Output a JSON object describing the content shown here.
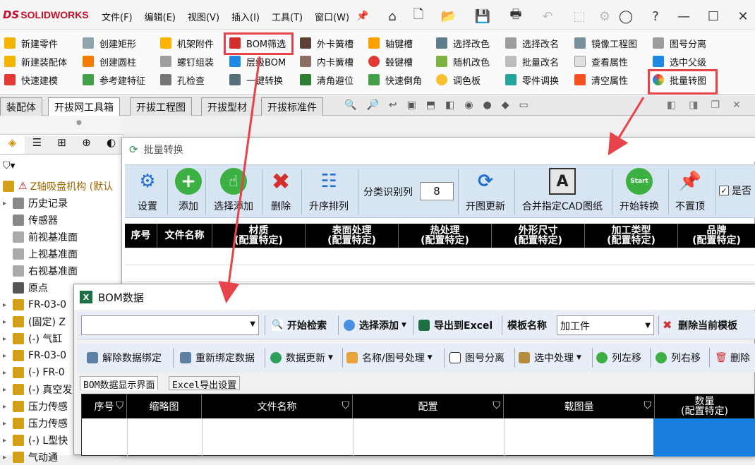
{
  "app": {
    "logo_ds": "DS",
    "logo_text": "SOLIDWORKS",
    "menus": [
      "文件(F)",
      "编辑(E)",
      "视图(V)",
      "插入(I)",
      "工具(T)",
      "窗口(W)"
    ]
  },
  "ribbon": {
    "col1": [
      "新建零件",
      "新建装配体",
      "快速建模"
    ],
    "col2": [
      "创建矩形",
      "创建圆柱",
      "参考建特征"
    ],
    "col3": [
      "机架附件",
      "螺钉组装",
      "孔检查"
    ],
    "col4": [
      "BOM筛选",
      "层级BOM",
      "一键转换"
    ],
    "col5": [
      "外卡簧槽",
      "内卡簧槽",
      "清角避位"
    ],
    "col6": [
      "轴键槽",
      "毂键槽",
      "快速倒角"
    ],
    "col7": [
      "选择改色",
      "随机改色",
      "调色板"
    ],
    "col8": [
      "选择改名",
      "批量改名",
      "零件调换"
    ],
    "col9": [
      "镜像工程图",
      "查看属性",
      "清空属性"
    ],
    "col10": [
      "图号分离",
      "选中父级",
      "批量转图"
    ]
  },
  "tabs": [
    "装配体",
    "开拔网工具箱",
    "开拔工程图",
    "开拔型材",
    "开拔标准件"
  ],
  "tree": {
    "root": "Z轴吸盘机构 (默认",
    "items": [
      "历史记录",
      "传感器",
      "前视基准面",
      "上视基准面",
      "右视基准面",
      "原点",
      "FR-03-0",
      "(固定) Z",
      "(-) 气缸",
      "FR-03-0",
      "(-) FR-0",
      "(-) 真空发",
      "压力传感",
      "压力传感",
      "(-) L型快",
      "气动通"
    ]
  },
  "batch": {
    "title": "批量转换",
    "buttons": [
      "设置",
      "添加",
      "选择添加",
      "删除",
      "升序排列",
      "开图更新",
      "合并指定CAD图纸",
      "开始转换",
      "不置顶"
    ],
    "classify_label": "分类识别列",
    "classify_value": "8",
    "checkbox_label": "是否",
    "columns": [
      {
        "t": "序号",
        "s": ""
      },
      {
        "t": "文件名称",
        "s": ""
      },
      {
        "t": "材质",
        "s": "(配置特定)"
      },
      {
        "t": "表面处理",
        "s": "(配置特定)"
      },
      {
        "t": "热处理",
        "s": "(配置特定)"
      },
      {
        "t": "外形尺寸",
        "s": "(配置特定)"
      },
      {
        "t": "加工类型",
        "s": "(配置特定)"
      },
      {
        "t": "品牌",
        "s": "(配置特定)"
      }
    ]
  },
  "bom": {
    "title": "BOM数据",
    "search_btn": "开始检索",
    "select_add": "选择添加",
    "export": "导出到Excel",
    "template_label": "模板名称",
    "template_value": "加工件",
    "delete_template": "删除当前模板",
    "tool2": [
      "解除数据绑定",
      "重新绑定数据",
      "数据更新",
      "名称/图号处理",
      "图号分离",
      "选中处理",
      "列左移",
      "列右移",
      "删除"
    ],
    "tabs": [
      "BOM数据显示界面",
      "Excel导出设置"
    ],
    "columns": [
      {
        "t": "序号",
        "f": true
      },
      {
        "t": "缩略图",
        "f": false
      },
      {
        "t": "文件名称",
        "f": true
      },
      {
        "t": "配置",
        "f": true
      },
      {
        "t": "载图量",
        "f": true
      },
      {
        "t": "数量",
        "s": "(配置特定)",
        "f": false
      }
    ]
  },
  "colors": {
    "highlight": "#e8424a",
    "blue_cell": "#1a7fdc",
    "toolbar_bg": "#d7e4f2"
  }
}
